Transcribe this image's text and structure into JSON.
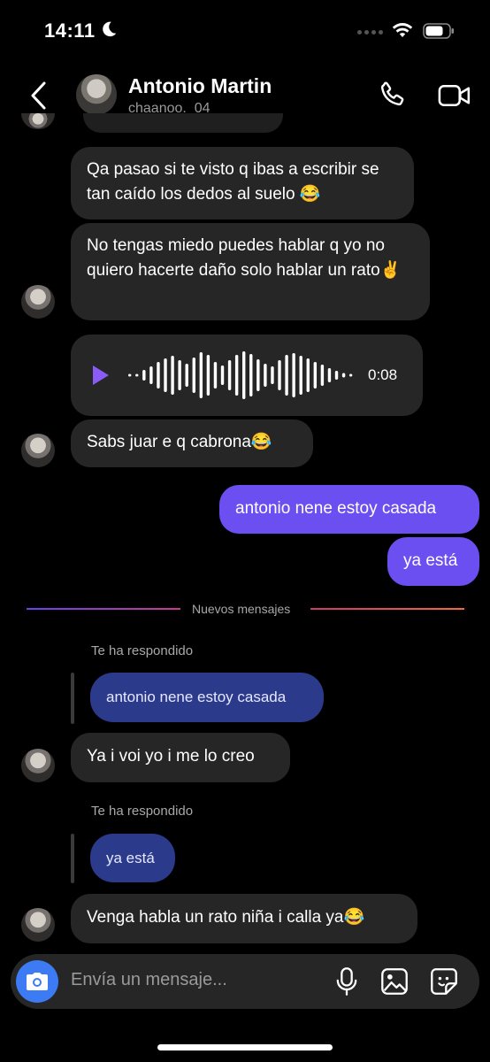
{
  "status_bar": {
    "time": "14:11"
  },
  "header": {
    "name": "Antonio Martin",
    "handle": "chaanoo._04"
  },
  "messages": {
    "m1": "Qa pasao si te visto q ibas a escribir se tan caído los dedos al suelo 😂",
    "m2": "No tengas miedo puedes hablar q yo no quiero hacerte daño solo hablar un rato✌️",
    "voice_duration": "0:08",
    "m3": "Sabs juar e q cabrona😂",
    "mine1": "antonio nene estoy casada",
    "mine2": "ya está",
    "divider": "Nuevos mensajes",
    "replied1_label": "Te ha respondido",
    "replied1_quote": "antonio nene estoy casada",
    "m4": "Ya i voi yo i me lo creo",
    "replied2_label": "Te ha respondido",
    "replied2_quote": "ya está",
    "m5": "Venga habla un rato niña i calla ya😂"
  },
  "composer": {
    "placeholder": "Envía un mensaje..."
  },
  "colors": {
    "accent": "#6b4ff0",
    "bubble_incoming": "#262626",
    "reply_quote": "#2b3a8a",
    "camera": "#3d7bf4"
  },
  "icons": [
    "moon-icon",
    "wifi-icon",
    "battery-icon",
    "back-icon",
    "phone-icon",
    "video-icon",
    "play-icon",
    "camera-icon",
    "microphone-icon",
    "gallery-icon",
    "sticker-icon"
  ]
}
